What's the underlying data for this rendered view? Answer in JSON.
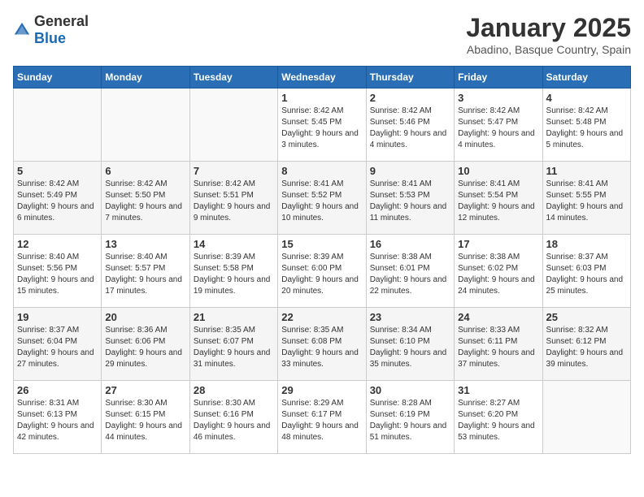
{
  "logo": {
    "general": "General",
    "blue": "Blue"
  },
  "header": {
    "title": "January 2025",
    "subtitle": "Abadino, Basque Country, Spain"
  },
  "weekdays": [
    "Sunday",
    "Monday",
    "Tuesday",
    "Wednesday",
    "Thursday",
    "Friday",
    "Saturday"
  ],
  "weeks": [
    [
      {
        "day": "",
        "info": ""
      },
      {
        "day": "",
        "info": ""
      },
      {
        "day": "",
        "info": ""
      },
      {
        "day": "1",
        "info": "Sunrise: 8:42 AM\nSunset: 5:45 PM\nDaylight: 9 hours and 3 minutes."
      },
      {
        "day": "2",
        "info": "Sunrise: 8:42 AM\nSunset: 5:46 PM\nDaylight: 9 hours and 4 minutes."
      },
      {
        "day": "3",
        "info": "Sunrise: 8:42 AM\nSunset: 5:47 PM\nDaylight: 9 hours and 4 minutes."
      },
      {
        "day": "4",
        "info": "Sunrise: 8:42 AM\nSunset: 5:48 PM\nDaylight: 9 hours and 5 minutes."
      }
    ],
    [
      {
        "day": "5",
        "info": "Sunrise: 8:42 AM\nSunset: 5:49 PM\nDaylight: 9 hours and 6 minutes."
      },
      {
        "day": "6",
        "info": "Sunrise: 8:42 AM\nSunset: 5:50 PM\nDaylight: 9 hours and 7 minutes."
      },
      {
        "day": "7",
        "info": "Sunrise: 8:42 AM\nSunset: 5:51 PM\nDaylight: 9 hours and 9 minutes."
      },
      {
        "day": "8",
        "info": "Sunrise: 8:41 AM\nSunset: 5:52 PM\nDaylight: 9 hours and 10 minutes."
      },
      {
        "day": "9",
        "info": "Sunrise: 8:41 AM\nSunset: 5:53 PM\nDaylight: 9 hours and 11 minutes."
      },
      {
        "day": "10",
        "info": "Sunrise: 8:41 AM\nSunset: 5:54 PM\nDaylight: 9 hours and 12 minutes."
      },
      {
        "day": "11",
        "info": "Sunrise: 8:41 AM\nSunset: 5:55 PM\nDaylight: 9 hours and 14 minutes."
      }
    ],
    [
      {
        "day": "12",
        "info": "Sunrise: 8:40 AM\nSunset: 5:56 PM\nDaylight: 9 hours and 15 minutes."
      },
      {
        "day": "13",
        "info": "Sunrise: 8:40 AM\nSunset: 5:57 PM\nDaylight: 9 hours and 17 minutes."
      },
      {
        "day": "14",
        "info": "Sunrise: 8:39 AM\nSunset: 5:58 PM\nDaylight: 9 hours and 19 minutes."
      },
      {
        "day": "15",
        "info": "Sunrise: 8:39 AM\nSunset: 6:00 PM\nDaylight: 9 hours and 20 minutes."
      },
      {
        "day": "16",
        "info": "Sunrise: 8:38 AM\nSunset: 6:01 PM\nDaylight: 9 hours and 22 minutes."
      },
      {
        "day": "17",
        "info": "Sunrise: 8:38 AM\nSunset: 6:02 PM\nDaylight: 9 hours and 24 minutes."
      },
      {
        "day": "18",
        "info": "Sunrise: 8:37 AM\nSunset: 6:03 PM\nDaylight: 9 hours and 25 minutes."
      }
    ],
    [
      {
        "day": "19",
        "info": "Sunrise: 8:37 AM\nSunset: 6:04 PM\nDaylight: 9 hours and 27 minutes."
      },
      {
        "day": "20",
        "info": "Sunrise: 8:36 AM\nSunset: 6:06 PM\nDaylight: 9 hours and 29 minutes."
      },
      {
        "day": "21",
        "info": "Sunrise: 8:35 AM\nSunset: 6:07 PM\nDaylight: 9 hours and 31 minutes."
      },
      {
        "day": "22",
        "info": "Sunrise: 8:35 AM\nSunset: 6:08 PM\nDaylight: 9 hours and 33 minutes."
      },
      {
        "day": "23",
        "info": "Sunrise: 8:34 AM\nSunset: 6:10 PM\nDaylight: 9 hours and 35 minutes."
      },
      {
        "day": "24",
        "info": "Sunrise: 8:33 AM\nSunset: 6:11 PM\nDaylight: 9 hours and 37 minutes."
      },
      {
        "day": "25",
        "info": "Sunrise: 8:32 AM\nSunset: 6:12 PM\nDaylight: 9 hours and 39 minutes."
      }
    ],
    [
      {
        "day": "26",
        "info": "Sunrise: 8:31 AM\nSunset: 6:13 PM\nDaylight: 9 hours and 42 minutes."
      },
      {
        "day": "27",
        "info": "Sunrise: 8:30 AM\nSunset: 6:15 PM\nDaylight: 9 hours and 44 minutes."
      },
      {
        "day": "28",
        "info": "Sunrise: 8:30 AM\nSunset: 6:16 PM\nDaylight: 9 hours and 46 minutes."
      },
      {
        "day": "29",
        "info": "Sunrise: 8:29 AM\nSunset: 6:17 PM\nDaylight: 9 hours and 48 minutes."
      },
      {
        "day": "30",
        "info": "Sunrise: 8:28 AM\nSunset: 6:19 PM\nDaylight: 9 hours and 51 minutes."
      },
      {
        "day": "31",
        "info": "Sunrise: 8:27 AM\nSunset: 6:20 PM\nDaylight: 9 hours and 53 minutes."
      },
      {
        "day": "",
        "info": ""
      }
    ]
  ]
}
